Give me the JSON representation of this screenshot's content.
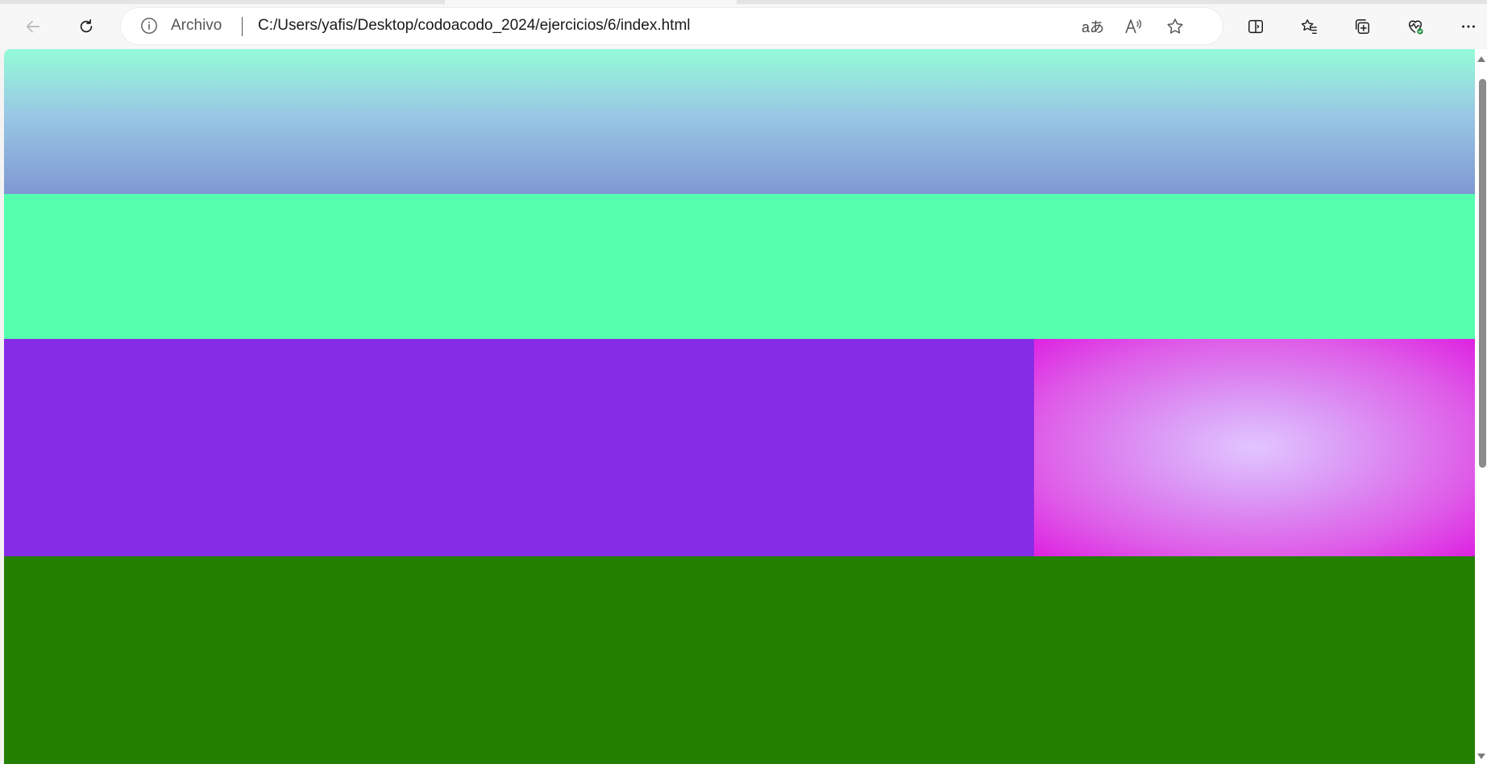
{
  "browser": {
    "security_label": "Archivo",
    "url": "C:/Users/yafis/Desktop/codoacodo_2024/ejercicios/6/index.html",
    "translate_glyph": "aあ",
    "toolbar_icons": [
      "back-icon",
      "refresh-icon",
      "info-icon",
      "translate-icon",
      "read-aloud-icon",
      "favorite-star-icon",
      "split-screen-icon",
      "favorites-icon",
      "collections-icon",
      "browser-essentials-icon",
      "more-menu-icon"
    ]
  },
  "page": {
    "colors": {
      "header_gradient": [
        "#94fbd8",
        "#99c8e4",
        "#7f98d3"
      ],
      "mint": "#55ffad",
      "purple": "#862ce6",
      "radial": [
        "#e1c6ff",
        "#dd22e1"
      ],
      "green": "#238000"
    }
  }
}
